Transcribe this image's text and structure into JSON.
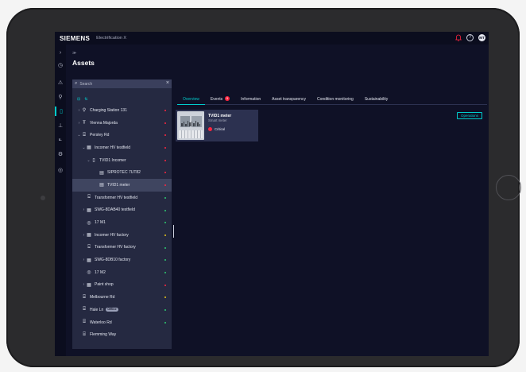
{
  "topbar": {
    "brand": "SIEMENS",
    "app_name": "Electrification X",
    "user_initials": "MT",
    "help_glyph": "?"
  },
  "rail_icons": [
    "expand-icon",
    "home-icon",
    "alarm-icon",
    "location-icon",
    "assets-icon",
    "hierarchy-icon",
    "analytics-icon",
    "gear-icon",
    "cycle-icon"
  ],
  "breadcrumb": "≫",
  "page_title": "Assets",
  "search": {
    "placeholder": "Search"
  },
  "tree": [
    {
      "label": "Charging Station 131",
      "icon": "⚲",
      "status": "#ff2640"
    },
    {
      "label": "Vienna Majorda",
      "icon": "Ŧ",
      "status": "#ff2640"
    },
    {
      "label": "Persley Rd",
      "icon": "⌸",
      "status": "#ff2640"
    },
    {
      "label": "Incomer HV testfield",
      "icon": "▦",
      "status": "#ff2640"
    },
    {
      "label": "TVID1 Incomer",
      "icon": "▯",
      "status": "#ff2640"
    },
    {
      "label": "SIPROTEC 7UT82",
      "icon": "▤",
      "status": "#ff2640"
    },
    {
      "label": "TVID1 meter",
      "icon": "▤",
      "status": "#ff2640"
    },
    {
      "label": "Transformer HV testfield",
      "icon": "⌺",
      "status": "#2ecc71"
    },
    {
      "label": "SWG-8DAB40 testfield",
      "icon": "▦",
      "status": "#2ecc71"
    },
    {
      "label": "17 M1",
      "icon": "◎",
      "status": "#2ecc71"
    },
    {
      "label": "Incomer HV factory",
      "icon": "▦",
      "status": "#e8c31a"
    },
    {
      "label": "Transformer HV factory",
      "icon": "⌺",
      "status": "#2ecc71"
    },
    {
      "label": "SWG-8DB10 factory",
      "icon": "▦",
      "status": "#2ecc71"
    },
    {
      "label": "17 M2",
      "icon": "◎",
      "status": "#2ecc71"
    },
    {
      "label": "Paint shop",
      "icon": "▦",
      "status": "#ff2640"
    },
    {
      "label": "Melbourne Rd",
      "icon": "⌸",
      "status": "#e8c31a"
    },
    {
      "label": "Hale Ln",
      "icon": "⌸",
      "status": "#2ecc71",
      "badge": "Offline"
    },
    {
      "label": "Waterloo Rd",
      "icon": "⌸",
      "status": "#2ecc71"
    },
    {
      "label": "Flemming Way",
      "icon": "⌸",
      "status": ""
    }
  ],
  "tabs": [
    {
      "label": "Overview",
      "active": true
    },
    {
      "label": "Events",
      "badge": "5"
    },
    {
      "label": "Information"
    },
    {
      "label": "Asset transparency"
    },
    {
      "label": "Condition monitoring"
    },
    {
      "label": "Sustainability"
    }
  ],
  "asset_card": {
    "title": "TVID1 meter",
    "subtitle": "Smart meter",
    "status": "Critical"
  },
  "operations_button": "Operations",
  "colors": {
    "accent": "#00cccc",
    "critical": "#ff2640",
    "ok": "#2ecc71",
    "warning": "#e8c31a"
  }
}
